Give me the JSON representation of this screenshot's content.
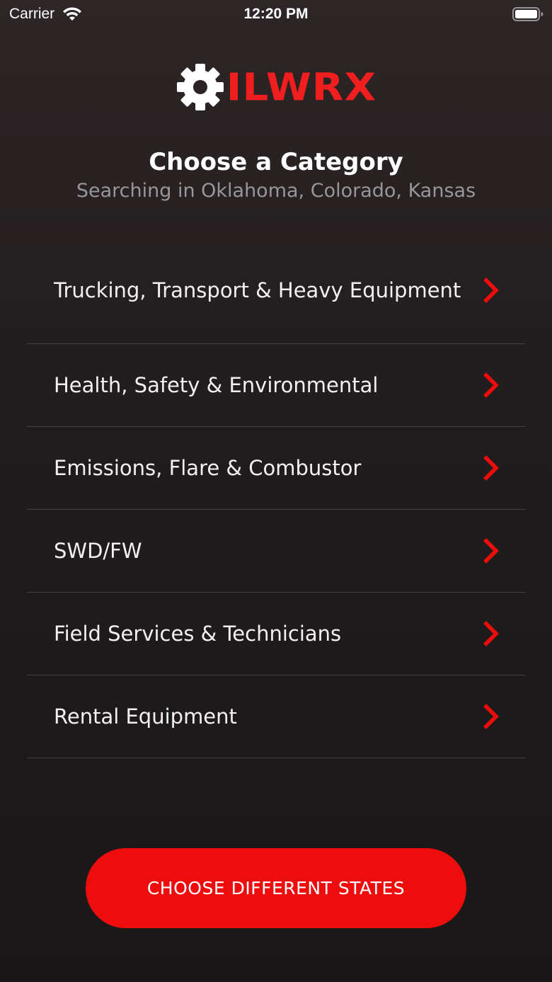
{
  "status_bar": {
    "carrier": "Carrier",
    "time": "12:20 PM",
    "wifi_icon": "wifi-icon",
    "battery_icon": "battery-icon"
  },
  "logo": {
    "icon": "gear-icon",
    "text": "ILWRX",
    "color": "#f01e1e"
  },
  "header": {
    "title": "Choose a Category",
    "subtitle": "Searching in Oklahoma, Colorado, Kansas"
  },
  "categories": [
    {
      "label": "Trucking, Transport & Heavy Equipment"
    },
    {
      "label": "Health, Safety & Environmental"
    },
    {
      "label": "Emissions, Flare & Combustor"
    },
    {
      "label": "SWD/FW"
    },
    {
      "label": "Field Services & Technicians"
    },
    {
      "label": "Rental Equipment"
    }
  ],
  "chevron_icon": "chevron-right-icon",
  "accent_color": "#ee0d0d",
  "primary_button": {
    "label": "CHOOSE DIFFERENT STATES"
  }
}
